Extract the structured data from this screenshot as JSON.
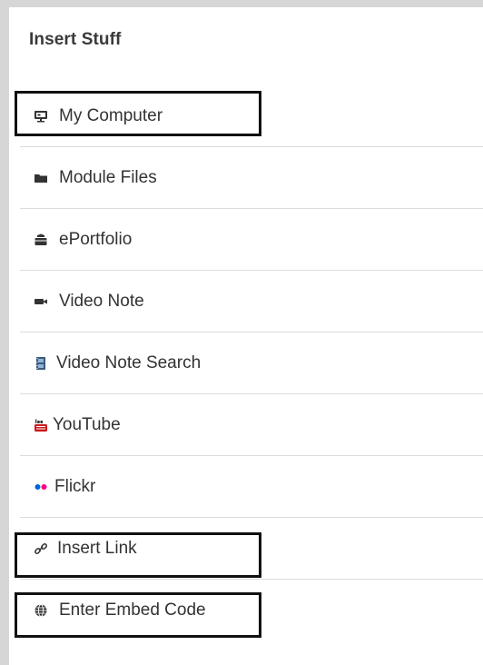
{
  "panel": {
    "title": "Insert Stuff"
  },
  "items": [
    {
      "label": "My Computer",
      "icon": "monitor-icon"
    },
    {
      "label": "Module Files",
      "icon": "folder-icon"
    },
    {
      "label": "ePortfolio",
      "icon": "briefcase-icon"
    },
    {
      "label": "Video Note",
      "icon": "video-camera-icon"
    },
    {
      "label": "Video Note Search",
      "icon": "film-icon"
    },
    {
      "label": "YouTube",
      "icon": "youtube-icon"
    },
    {
      "label": "Flickr",
      "icon": "flickr-icon"
    },
    {
      "label": "Insert Link",
      "icon": "link-icon"
    },
    {
      "label": "Enter Embed Code",
      "icon": "globe-icon"
    }
  ],
  "colors": {
    "text": "#333333",
    "separator": "#dcdcdc",
    "highlight_border": "#111111",
    "frame": "#d6d6d6",
    "youtube_red": "#cc181e",
    "flickr_blue": "#0063dc",
    "flickr_pink": "#ff0084"
  }
}
